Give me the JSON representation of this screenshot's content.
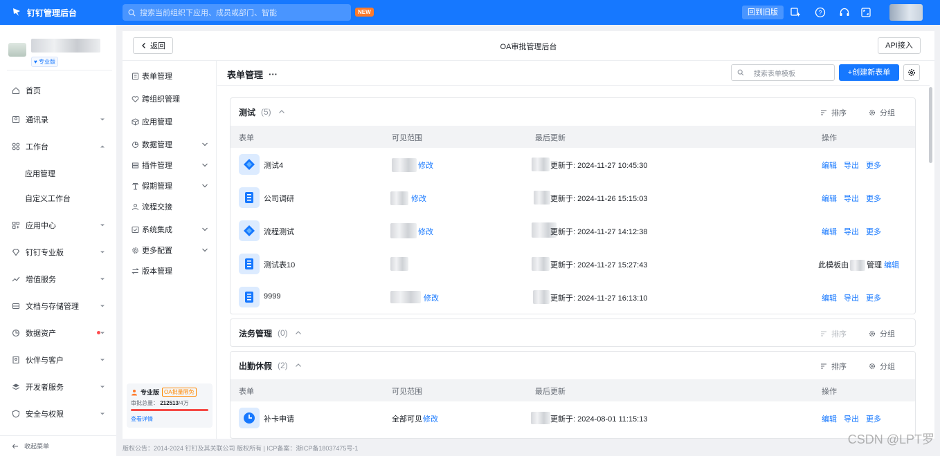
{
  "topbar": {
    "app_title": "钉钉管理后台",
    "search_placeholder": "搜索当前组织下应用、成员或部门、智能",
    "new_badge": "NEW",
    "old_version_button": "回到旧版",
    "icons": [
      "app-plus-icon",
      "help-icon",
      "headset-icon",
      "fullscreen-icon"
    ],
    "accent_color": "#1678ff"
  },
  "sidebar": {
    "org_badge": "专业版",
    "items": [
      {
        "label": "首页",
        "icon": "home-icon"
      },
      {
        "label": "通讯录",
        "icon": "contacts-icon",
        "arrow": "down"
      },
      {
        "label": "工作台",
        "icon": "workbench-icon",
        "arrow": "up"
      },
      {
        "label": "应用管理",
        "sub": true
      },
      {
        "label": "自定义工作台",
        "sub": true
      },
      {
        "label": "应用中心",
        "icon": "app-center-icon",
        "arrow": "down"
      },
      {
        "label": "钉钉专业版",
        "icon": "diamond-icon",
        "arrow": "down"
      },
      {
        "label": "增值服务",
        "icon": "trend-icon",
        "arrow": "down"
      },
      {
        "label": "文档与存储管理",
        "icon": "storage-icon",
        "arrow": "down"
      },
      {
        "label": "数据资产",
        "icon": "data-icon",
        "arrow": "down",
        "dot": true
      },
      {
        "label": "伙伴与客户",
        "icon": "partner-icon",
        "arrow": "down"
      },
      {
        "label": "开发者服务",
        "icon": "layers-icon",
        "arrow": "down"
      },
      {
        "label": "安全与权限",
        "icon": "shield-icon",
        "arrow": "down"
      }
    ],
    "collapse_label": "收起菜单"
  },
  "panel": {
    "back_label": "返回",
    "title": "OA审批管理后台",
    "api_label": "API接入"
  },
  "subnav": {
    "items": [
      {
        "label": "表单管理",
        "icon": "form-icon"
      },
      {
        "label": "跨组织管理",
        "icon": "heart-icon"
      },
      {
        "label": "应用管理",
        "icon": "box-icon"
      },
      {
        "label": "数据管理",
        "icon": "data-icon",
        "chevron": true
      },
      {
        "label": "插件管理",
        "icon": "plugin-icon",
        "chevron": true
      },
      {
        "label": "假期管理",
        "icon": "holiday-icon",
        "chevron": true
      },
      {
        "label": "流程交接",
        "icon": "user-icon"
      },
      {
        "label": "系统集成",
        "icon": "integration-icon",
        "chevron": true
      },
      {
        "label": "更多配置",
        "icon": "gear-icon",
        "chevron": true
      },
      {
        "label": "版本管理",
        "icon": "version-icon"
      }
    ],
    "promo": {
      "title": "专业版",
      "tag": "OA批量限免",
      "usage_label": "审批总量：",
      "usage_value": "212513",
      "usage_total": "/4万",
      "usage_fraction": 1.0,
      "detail_link": "查看详情"
    }
  },
  "content": {
    "title": "表单管理",
    "more": "···",
    "search_placeholder": "搜索表单模板",
    "create_label": "+创建新表单",
    "columns": {
      "form": "表单",
      "scope": "可见范围",
      "updated": "最后更新",
      "ops": "操作"
    },
    "group_actions": {
      "sort": "排序",
      "group": "分组"
    },
    "ops": {
      "edit": "编辑",
      "export": "导出",
      "more": "更多"
    },
    "modify": "修改",
    "updated_prefix": "更新于:",
    "groups": [
      {
        "name": "测试",
        "count": "(5)",
        "rows": [
          {
            "name": "测试4",
            "icon": "diamond",
            "scope_link": "修改",
            "updated": "2024-11-27 10:45:30"
          },
          {
            "name": "公司调研",
            "icon": "doc",
            "scope_link": "修改",
            "updated": "2024-11-26 15:15:03"
          },
          {
            "name": "流程测试",
            "icon": "diamond",
            "scope_link": "修改",
            "updated": "2024-11-27 14:12:38"
          },
          {
            "name": "测试表10",
            "icon": "doc",
            "scope_link": "",
            "updated": "2024-11-27 15:27:43",
            "owner_prefix": "此模板由",
            "owner_suffix": "管理",
            "owner_link": "编辑"
          },
          {
            "name": "9999",
            "icon": "doc",
            "scope_link": "修改",
            "updated": "2024-11-27 16:13:10"
          }
        ]
      },
      {
        "name": "法务管理",
        "count": "(0)",
        "rows": []
      },
      {
        "name": "出勤休假",
        "count": "(2)",
        "rows": [
          {
            "name": "补卡申请",
            "icon": "clock",
            "scope_text": "全部可见",
            "scope_link": "修改",
            "updated": "2024-08-01 11:15:13"
          }
        ]
      }
    ]
  },
  "footer": {
    "text": "版权公告：2014-2024 钉钉及其关联公司 版权所有 | ICP备案：浙ICP备18037475号-1"
  },
  "watermark": "CSDN @LPT罗"
}
